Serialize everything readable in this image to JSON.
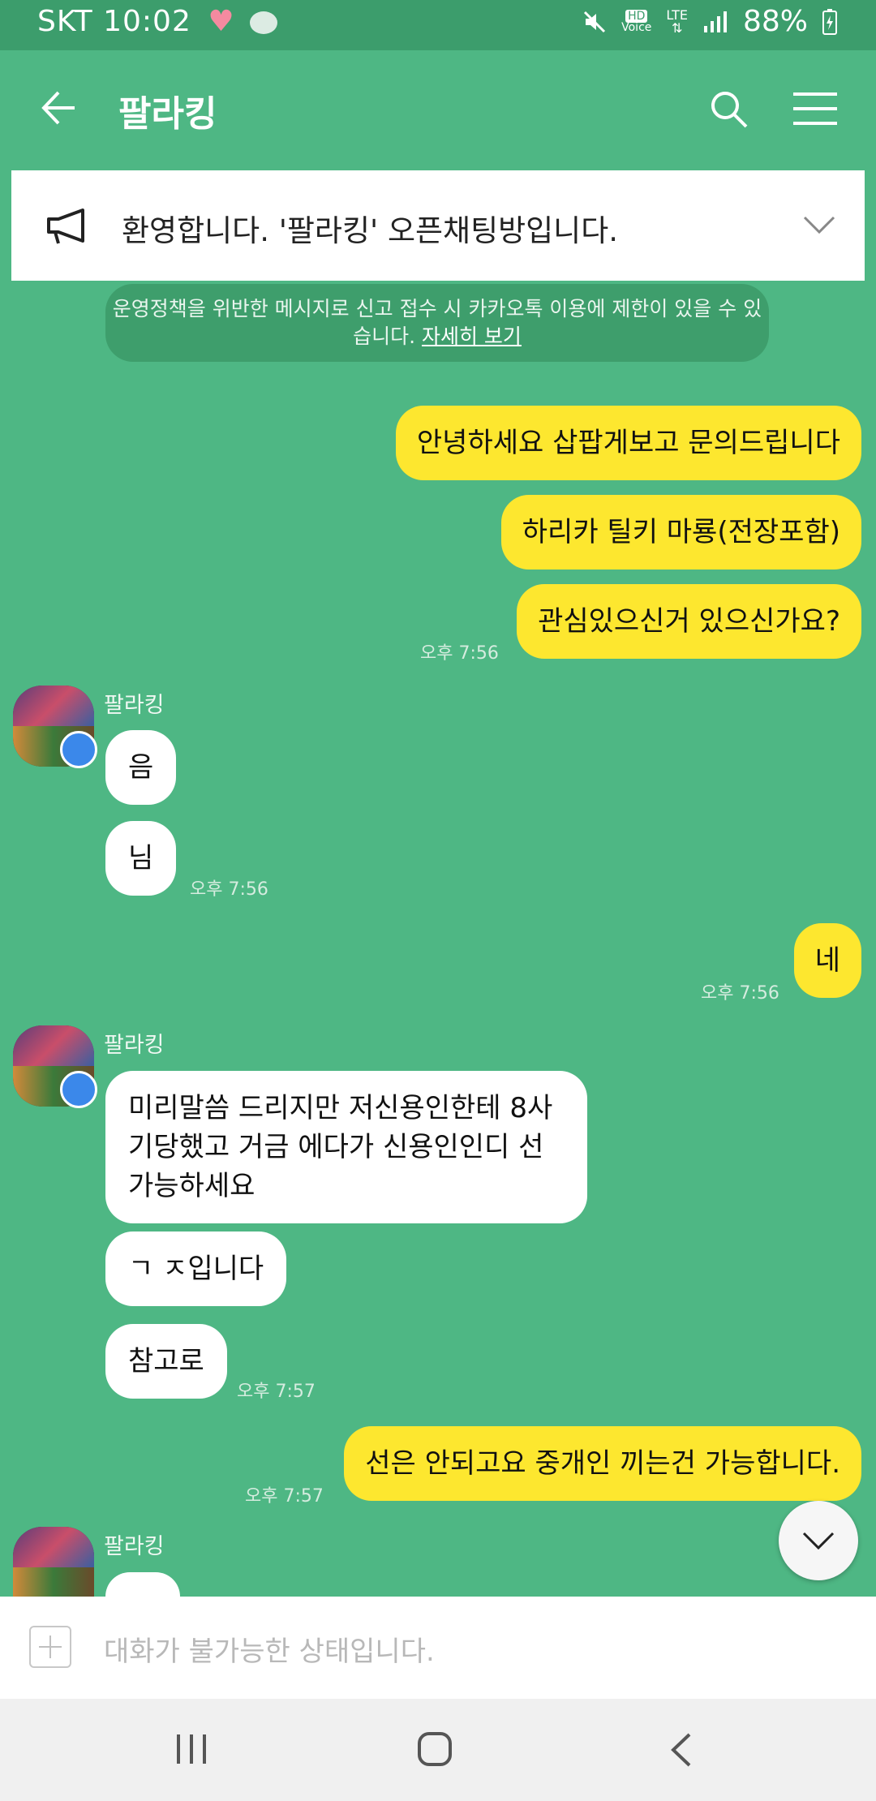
{
  "status_bar": {
    "carrier": "SKT",
    "time": "10:02",
    "network": "LTE",
    "hd_label": "HD",
    "voice_label": "Voice",
    "battery": "88%"
  },
  "header": {
    "title": "팔라킹"
  },
  "notice": {
    "text": "환영합니다. '팔라킹' 오픈채팅방입니다."
  },
  "policy": {
    "text": "운영정책을 위반한 메시지로 신고 접수 시 카카오톡 이용에 제한이 있을 수 있습니다.",
    "link": "자세히 보기"
  },
  "messages": {
    "m1": "안녕하세요 삽팝게보고 문의드립니다",
    "m2": "하리카 틸키 마룡(전장포함)",
    "m3": "관심있으신거 있으신가요?",
    "t1": "오후 7:56",
    "sender": "팔라킹",
    "o1": "음",
    "o2": "님",
    "t2": "오후 7:56",
    "m4": "네",
    "t3": "오후 7:56",
    "o3": "미리말씀 드리지만 저신용인한테 8사기당했고 거금 에다가 신용인인디 선가능하세요",
    "o4": "ㄱ ㅈ입니다",
    "o5": "참고로",
    "t4": "오후 7:57",
    "m5": "선은 안되고요 중개인 끼는건 가능합니다.",
    "t5": "오후 7:57"
  },
  "input": {
    "placeholder": "대화가 불가능한 상태입니다."
  },
  "colors": {
    "background": "#4eb784",
    "my_bubble": "#fde72f",
    "other_bubble": "#ffffff"
  }
}
